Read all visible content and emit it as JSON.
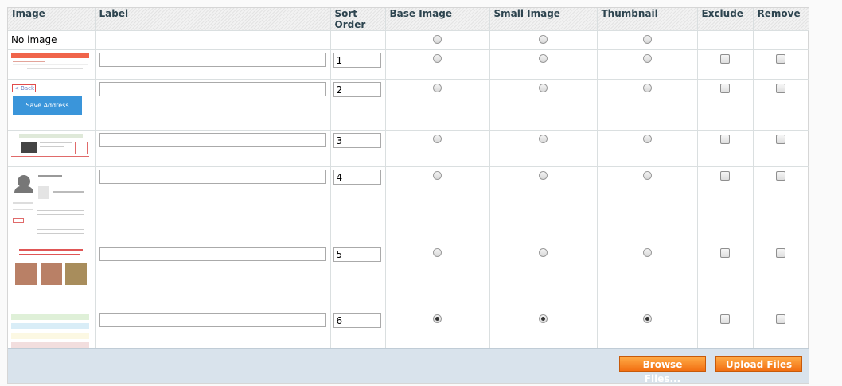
{
  "columns": {
    "image": "Image",
    "label": "Label",
    "sort_order": "Sort Order",
    "base_image": "Base Image",
    "small_image": "Small Image",
    "thumbnail": "Thumbnail",
    "exclude": "Exclude",
    "remove": "Remove"
  },
  "no_image": {
    "text": "No image",
    "base": false,
    "small": false,
    "thumbnail": false
  },
  "rows": [
    {
      "label": "",
      "sort_order": "1",
      "base": false,
      "small": false,
      "thumbnail": false,
      "exclude": false,
      "remove": false
    },
    {
      "label": "",
      "sort_order": "2",
      "base": false,
      "small": false,
      "thumbnail": false,
      "exclude": false,
      "remove": false,
      "thumb_text": {
        "back": "< Back",
        "save": "Save Address"
      }
    },
    {
      "label": "",
      "sort_order": "3",
      "base": false,
      "small": false,
      "thumbnail": false,
      "exclude": false,
      "remove": false
    },
    {
      "label": "",
      "sort_order": "4",
      "base": false,
      "small": false,
      "thumbnail": false,
      "exclude": false,
      "remove": false
    },
    {
      "label": "",
      "sort_order": "5",
      "base": false,
      "small": false,
      "thumbnail": false,
      "exclude": false,
      "remove": false
    },
    {
      "label": "",
      "sort_order": "6",
      "base": true,
      "small": true,
      "thumbnail": true,
      "exclude": false,
      "remove": false
    }
  ],
  "footer": {
    "browse_label": "Browse Files...",
    "upload_label": "Upload Files"
  },
  "colors": {
    "button_top": "#ffac47",
    "button_bottom": "#f26f12",
    "footer_bg": "#d9e3ec"
  }
}
